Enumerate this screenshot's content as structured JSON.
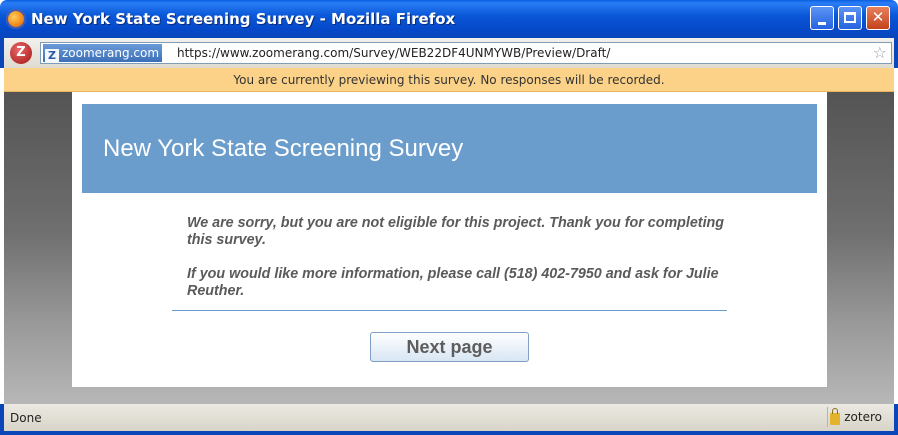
{
  "window": {
    "title": "New York State Screening Survey - Mozilla Firefox",
    "min_glyph": "",
    "max_glyph": "",
    "close_glyph": "✕"
  },
  "navbar": {
    "site_identity": "zoomerang.com",
    "favicon_letter": "Z",
    "url": "https://www.zoomerang.com/Survey/WEB22DF4UNMYWB/Preview/Draft/",
    "star_glyph": "☆",
    "addon_letter": "Z"
  },
  "preview_notice": "You are currently previewing this survey. No responses will be recorded.",
  "survey": {
    "title": "New York State Screening Survey",
    "message_1": "We are sorry, but you are not eligible for this project.  Thank you for completing this survey.",
    "message_2": "If you would like more information, please call (518) 402-7950 and ask for Julie Reuther.",
    "next_button": "Next page"
  },
  "statusbar": {
    "status": "Done",
    "addon": "zotero"
  },
  "colors": {
    "titlebar": "#0a58d8",
    "preview_bar": "#fbd287",
    "survey_header": "#6a9ccc"
  }
}
